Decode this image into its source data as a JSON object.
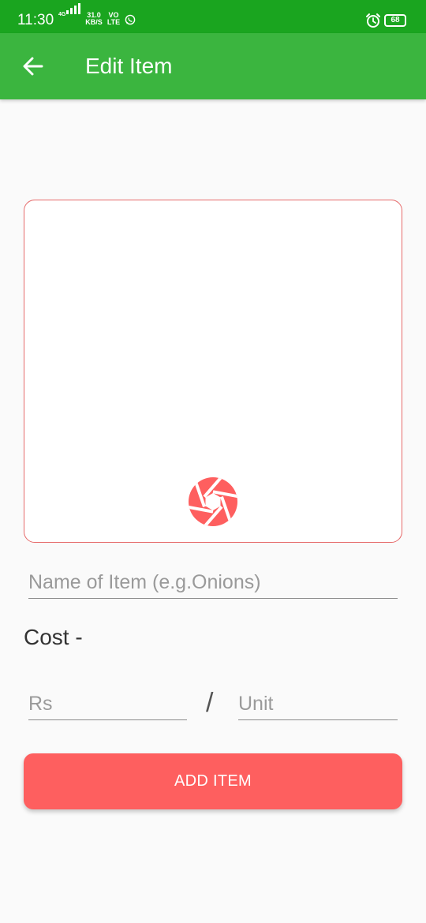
{
  "status_bar": {
    "time": "11:30",
    "network_type": "4G",
    "speed_value": "31.0",
    "speed_unit": "KB/S",
    "volte_top": "VO",
    "volte_bottom": "LTE",
    "battery": "68",
    "icons": [
      "signal-icon",
      "whatsapp-icon",
      "alarm-icon",
      "battery-icon"
    ]
  },
  "app_bar": {
    "title": "Edit Item",
    "back_icon": "arrow-left-icon"
  },
  "image_picker": {
    "icon": "camera-shutter-icon"
  },
  "form": {
    "name_placeholder": "Name of Item (e.g.Onions)",
    "cost_label": "Cost -",
    "price_placeholder": "Rs",
    "separator": "/",
    "unit_placeholder": "Unit",
    "submit_label": "ADD ITEM"
  },
  "colors": {
    "status_bar": "#1aa51f",
    "app_bar": "#3bb53f",
    "accent": "#fe5f5f",
    "card_border": "#e66a6a",
    "background": "#fafafa"
  }
}
